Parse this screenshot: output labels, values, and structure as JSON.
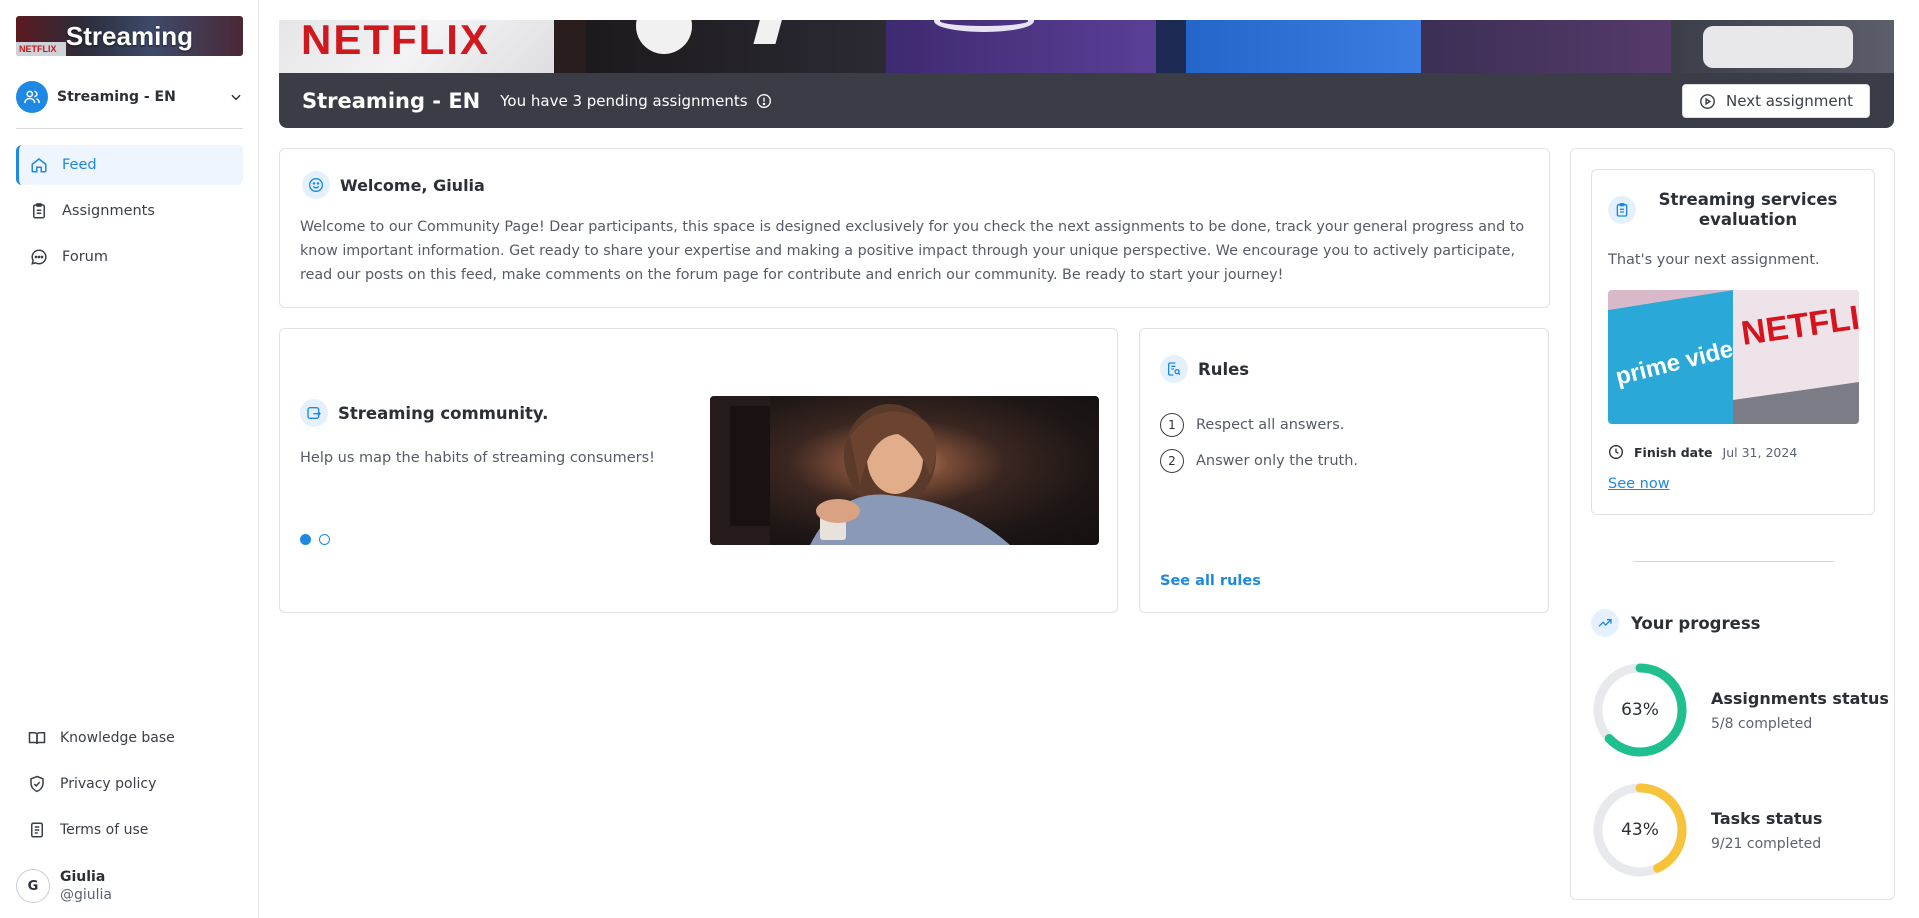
{
  "sidebar": {
    "logo_text": "Streaming",
    "logo_strip_text": "NETFLIX",
    "community_name": "Streaming - EN",
    "nav": [
      {
        "label": "Feed"
      },
      {
        "label": "Assignments"
      },
      {
        "label": "Forum"
      }
    ],
    "footer": [
      {
        "label": "Knowledge base"
      },
      {
        "label": "Privacy policy"
      },
      {
        "label": "Terms of use"
      }
    ],
    "user": {
      "initial": "G",
      "name": "Giulia",
      "handle": "@giulia"
    }
  },
  "hero": {
    "title": "Streaming - EN",
    "subtitle": "You have 3 pending assignments",
    "next_button": "Next assignment"
  },
  "welcome": {
    "title": "Welcome, Giulia",
    "text": "Welcome to our Community Page! Dear participants, this space is designed exclusively for you check the next assignments to be done, track your general progress and to know important information. Get ready to share your expertise and making a positive impact through your unique perspective. We encourage you to actively participate, read our posts on this feed, make comments on the forum page for contribute and enrich our community. Be ready to start your journey!"
  },
  "community_card": {
    "title": "Streaming community.",
    "text": "Help us map the habits of streaming consumers!"
  },
  "rules": {
    "title": "Rules",
    "items": [
      {
        "num": "1",
        "text": "Respect all answers."
      },
      {
        "num": "2",
        "text": "Answer only the truth."
      }
    ],
    "link": "See all rules"
  },
  "assignment": {
    "title": "Streaming services evaluation",
    "subtitle": "That's your next assignment.",
    "finish_label": "Finish date",
    "finish_date": "Jul 31, 2024",
    "link": "See now",
    "image_texts": {
      "left": "prime video",
      "right": "NETFLIX"
    }
  },
  "progress": {
    "title": "Your progress",
    "items": [
      {
        "percent_label": "63%",
        "value": 0.63,
        "title": "Assignments status",
        "sub": "5/8 completed",
        "color": "#1fbf8f"
      },
      {
        "percent_label": "43%",
        "value": 0.43,
        "title": "Tasks status",
        "sub": "9/21 completed",
        "color": "#f7c33b"
      }
    ]
  },
  "colors": {
    "accent": "#1e88e5",
    "hero_bar": "#3a3d45"
  }
}
